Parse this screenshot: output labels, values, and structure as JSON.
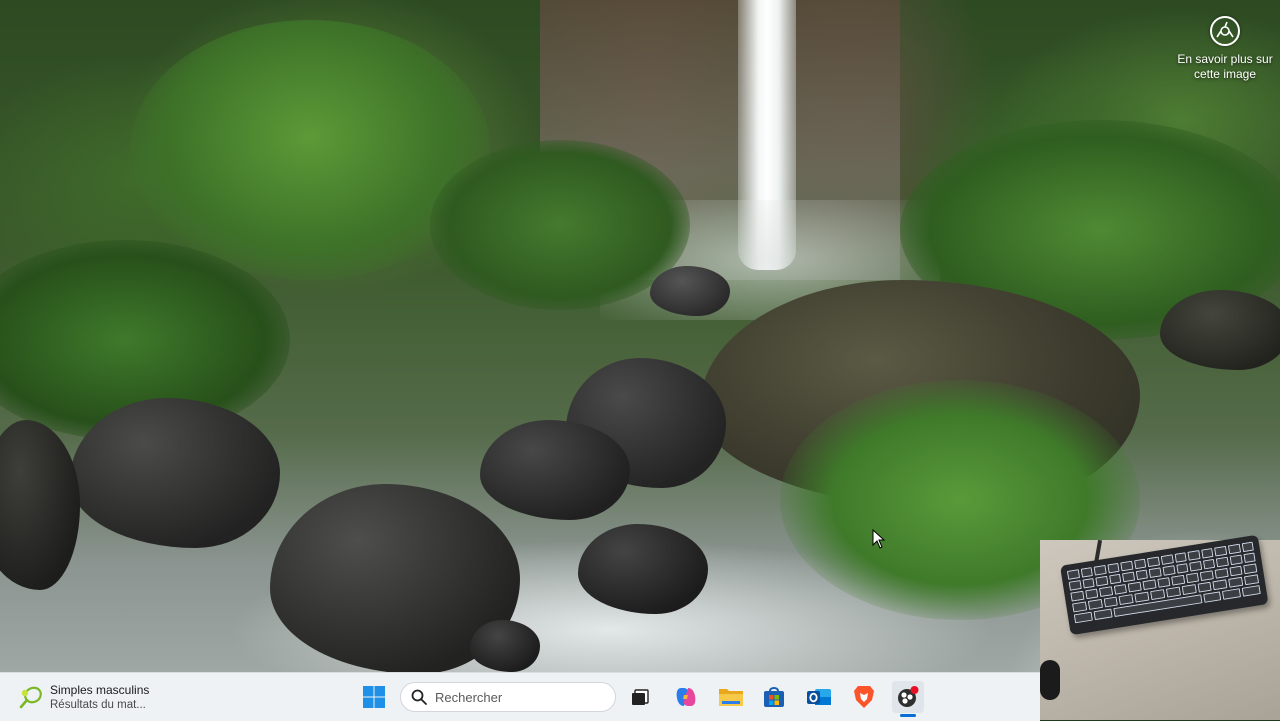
{
  "desktop": {
    "learn_more": {
      "line1": "En savoir plus sur",
      "line2": "cette image",
      "icon": "camera-aperture-icon"
    }
  },
  "taskbar": {
    "widget": {
      "title": "Simples masculins",
      "subtitle": "Résultats du mat...",
      "icon": "tennis-icon"
    },
    "search": {
      "placeholder": "Rechercher"
    },
    "apps": [
      {
        "name": "start",
        "icon": "windows-logo-icon"
      },
      {
        "name": "task-view",
        "icon": "task-view-icon"
      },
      {
        "name": "copilot",
        "icon": "copilot-icon"
      },
      {
        "name": "file-explorer",
        "icon": "folder-icon"
      },
      {
        "name": "microsoft-store",
        "icon": "store-icon"
      },
      {
        "name": "outlook",
        "icon": "outlook-icon"
      },
      {
        "name": "brave",
        "icon": "brave-lion-icon"
      },
      {
        "name": "obs-studio",
        "icon": "obs-record-icon",
        "active": true
      }
    ],
    "colors": {
      "background": "#eef2f5",
      "accent": "#0a6cd6"
    }
  },
  "overlay": {
    "webcam": "keyboard-webcam-feed"
  }
}
